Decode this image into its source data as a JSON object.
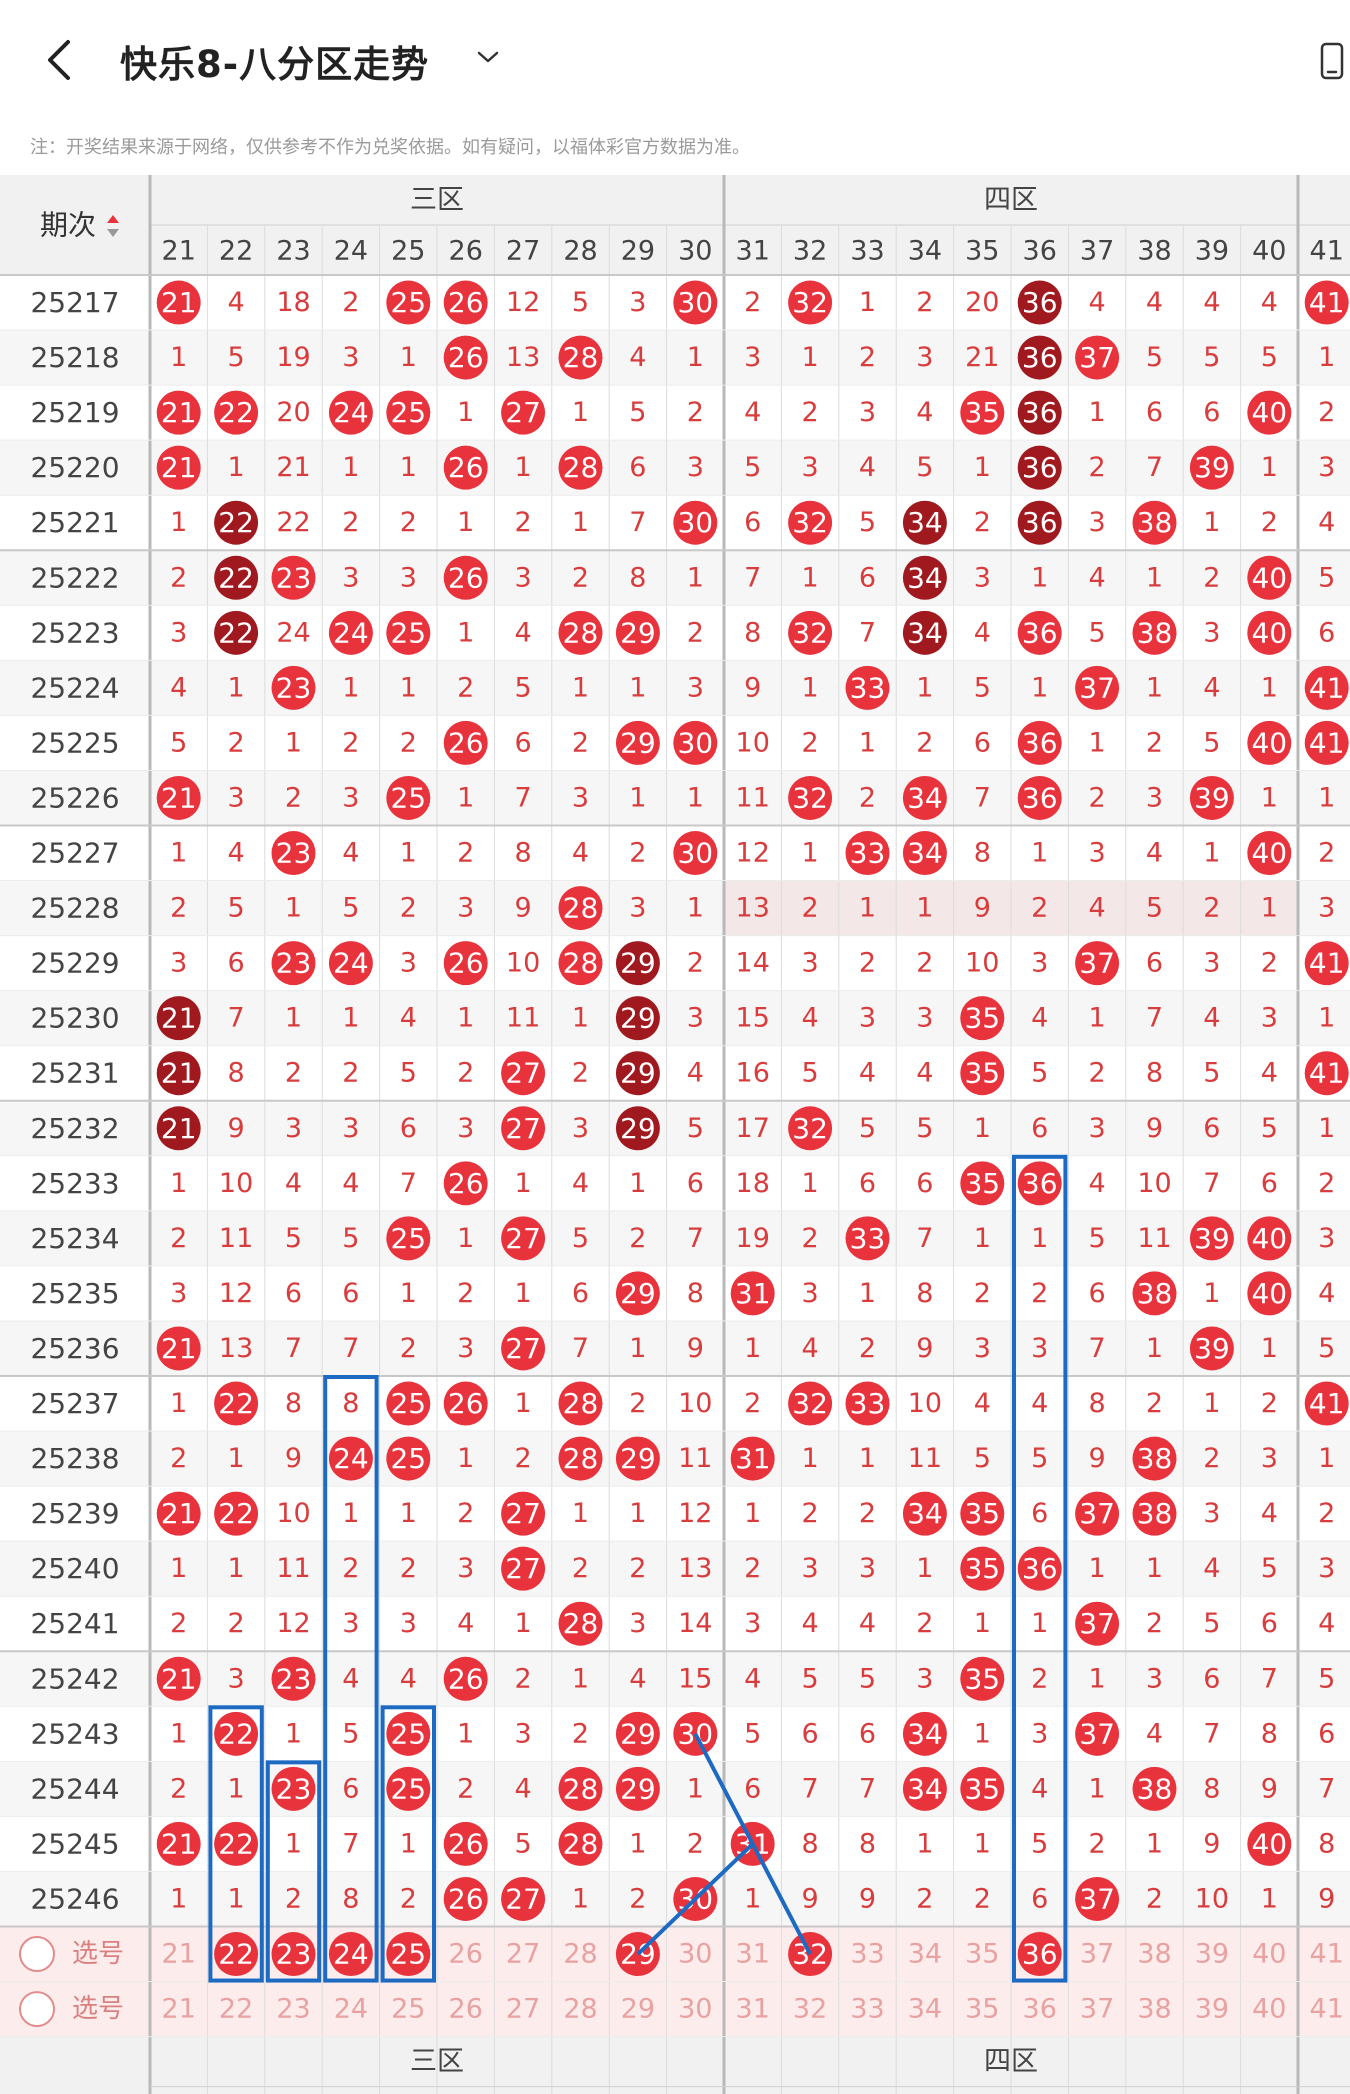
{
  "header": {
    "title": "快乐8-八分区走势",
    "note": "注：开奖结果来源于网络，仅供参考不作为兑奖依据。如有疑问，以福体彩官方数据为准。"
  },
  "table": {
    "period_header": "期次",
    "zones": [
      {
        "label": "三区",
        "first": 21,
        "last": 30
      },
      {
        "label": "四区",
        "first": 31,
        "last": 40
      }
    ],
    "extra_col": "41",
    "cols": [
      "21",
      "22",
      "23",
      "24",
      "25",
      "26",
      "27",
      "28",
      "29",
      "30",
      "31",
      "32",
      "33",
      "34",
      "35",
      "36",
      "37",
      "38",
      "39",
      "40",
      "41"
    ],
    "rows": [
      {
        "period": "25217",
        "cells": [
          "21",
          "4",
          "18",
          "2",
          "25",
          "26",
          "12",
          "5",
          "3",
          "30",
          "2",
          "32",
          "1",
          "2",
          "20",
          "36",
          "4",
          "4",
          "4",
          "4",
          "41"
        ]
      },
      {
        "period": "25218",
        "cells": [
          "1",
          "5",
          "19",
          "3",
          "1",
          "26",
          "13",
          "28",
          "4",
          "1",
          "3",
          "1",
          "2",
          "3",
          "21",
          "36",
          "37",
          "5",
          "5",
          "5",
          "1"
        ]
      },
      {
        "period": "25219",
        "cells": [
          "21",
          "22",
          "20",
          "24",
          "25",
          "1",
          "27",
          "1",
          "5",
          "2",
          "4",
          "2",
          "3",
          "4",
          "35",
          "36",
          "1",
          "6",
          "6",
          "40",
          "2"
        ]
      },
      {
        "period": "25220",
        "cells": [
          "21",
          "1",
          "21",
          "1",
          "1",
          "26",
          "1",
          "28",
          "6",
          "3",
          "5",
          "3",
          "4",
          "5",
          "1",
          "36",
          "2",
          "7",
          "39",
          "1",
          "3"
        ]
      },
      {
        "period": "25221",
        "cells": [
          "1",
          "22",
          "22",
          "2",
          "2",
          "1",
          "2",
          "1",
          "7",
          "30",
          "6",
          "32",
          "5",
          "34",
          "2",
          "36",
          "3",
          "38",
          "1",
          "2",
          "4"
        ]
      },
      {
        "period": "25222",
        "cells": [
          "2",
          "22",
          "23",
          "3",
          "3",
          "26",
          "3",
          "2",
          "8",
          "1",
          "7",
          "1",
          "6",
          "34",
          "3",
          "1",
          "4",
          "1",
          "2",
          "40",
          "5"
        ]
      },
      {
        "period": "25223",
        "cells": [
          "3",
          "22",
          "24",
          "24",
          "25",
          "1",
          "4",
          "28",
          "29",
          "2",
          "8",
          "32",
          "7",
          "34",
          "4",
          "36",
          "5",
          "38",
          "3",
          "40",
          "6"
        ]
      },
      {
        "period": "25224",
        "cells": [
          "4",
          "1",
          "23",
          "1",
          "1",
          "2",
          "5",
          "1",
          "1",
          "3",
          "9",
          "1",
          "33",
          "1",
          "5",
          "1",
          "37",
          "1",
          "4",
          "1",
          "41"
        ]
      },
      {
        "period": "25225",
        "cells": [
          "5",
          "2",
          "1",
          "2",
          "2",
          "26",
          "6",
          "2",
          "29",
          "30",
          "10",
          "2",
          "1",
          "2",
          "6",
          "36",
          "1",
          "2",
          "5",
          "40",
          "41"
        ]
      },
      {
        "period": "25226",
        "cells": [
          "21",
          "3",
          "2",
          "3",
          "25",
          "1",
          "7",
          "3",
          "1",
          "1",
          "11",
          "32",
          "2",
          "34",
          "7",
          "36",
          "2",
          "3",
          "39",
          "1",
          "1"
        ]
      },
      {
        "period": "25227",
        "cells": [
          "1",
          "4",
          "23",
          "4",
          "1",
          "2",
          "8",
          "4",
          "2",
          "30",
          "12",
          "1",
          "33",
          "34",
          "8",
          "1",
          "3",
          "4",
          "1",
          "40",
          "2"
        ]
      },
      {
        "period": "25228",
        "cells": [
          "2",
          "5",
          "1",
          "5",
          "2",
          "3",
          "9",
          "28",
          "3",
          "1",
          "13",
          "2",
          "1",
          "1",
          "9",
          "2",
          "4",
          "5",
          "2",
          "1",
          "3"
        ]
      },
      {
        "period": "25229",
        "cells": [
          "3",
          "6",
          "23",
          "24",
          "3",
          "26",
          "10",
          "28",
          "29",
          "2",
          "14",
          "3",
          "2",
          "2",
          "10",
          "3",
          "37",
          "6",
          "3",
          "2",
          "41"
        ]
      },
      {
        "period": "25230",
        "cells": [
          "21",
          "7",
          "1",
          "1",
          "4",
          "1",
          "11",
          "1",
          "29",
          "3",
          "15",
          "4",
          "3",
          "3",
          "35",
          "4",
          "1",
          "7",
          "4",
          "3",
          "1"
        ]
      },
      {
        "period": "25231",
        "cells": [
          "21",
          "8",
          "2",
          "2",
          "5",
          "2",
          "27",
          "2",
          "29",
          "4",
          "16",
          "5",
          "4",
          "4",
          "35",
          "5",
          "2",
          "8",
          "5",
          "4",
          "41"
        ]
      },
      {
        "period": "25232",
        "cells": [
          "21",
          "9",
          "3",
          "3",
          "6",
          "3",
          "27",
          "3",
          "29",
          "5",
          "17",
          "32",
          "5",
          "5",
          "1",
          "6",
          "3",
          "9",
          "6",
          "5",
          "1"
        ]
      },
      {
        "period": "25233",
        "cells": [
          "1",
          "10",
          "4",
          "4",
          "7",
          "26",
          "1",
          "4",
          "1",
          "6",
          "18",
          "1",
          "6",
          "6",
          "35",
          "36",
          "4",
          "10",
          "7",
          "6",
          "2"
        ]
      },
      {
        "period": "25234",
        "cells": [
          "2",
          "11",
          "5",
          "5",
          "25",
          "1",
          "27",
          "5",
          "2",
          "7",
          "19",
          "2",
          "33",
          "7",
          "1",
          "1",
          "5",
          "11",
          "39",
          "40",
          "3"
        ]
      },
      {
        "period": "25235",
        "cells": [
          "3",
          "12",
          "6",
          "6",
          "1",
          "2",
          "1",
          "6",
          "29",
          "8",
          "31",
          "3",
          "1",
          "8",
          "2",
          "2",
          "6",
          "38",
          "1",
          "40",
          "4"
        ]
      },
      {
        "period": "25236",
        "cells": [
          "21",
          "13",
          "7",
          "7",
          "2",
          "3",
          "27",
          "7",
          "1",
          "9",
          "1",
          "4",
          "2",
          "9",
          "3",
          "3",
          "7",
          "1",
          "39",
          "1",
          "5"
        ]
      },
      {
        "period": "25237",
        "cells": [
          "1",
          "22",
          "8",
          "8",
          "25",
          "26",
          "1",
          "28",
          "2",
          "10",
          "2",
          "32",
          "33",
          "10",
          "4",
          "4",
          "8",
          "2",
          "1",
          "2",
          "41"
        ]
      },
      {
        "period": "25238",
        "cells": [
          "2",
          "1",
          "9",
          "24",
          "25",
          "1",
          "2",
          "28",
          "29",
          "11",
          "31",
          "1",
          "1",
          "11",
          "5",
          "5",
          "9",
          "38",
          "2",
          "3",
          "1"
        ]
      },
      {
        "period": "25239",
        "cells": [
          "21",
          "22",
          "10",
          "1",
          "1",
          "2",
          "27",
          "1",
          "1",
          "12",
          "1",
          "2",
          "2",
          "34",
          "35",
          "6",
          "37",
          "38",
          "3",
          "4",
          "2"
        ]
      },
      {
        "period": "25240",
        "cells": [
          "1",
          "1",
          "11",
          "2",
          "2",
          "3",
          "27",
          "2",
          "2",
          "13",
          "2",
          "3",
          "3",
          "1",
          "35",
          "36",
          "1",
          "1",
          "4",
          "5",
          "3"
        ]
      },
      {
        "period": "25241",
        "cells": [
          "2",
          "2",
          "12",
          "3",
          "3",
          "4",
          "1",
          "28",
          "3",
          "14",
          "3",
          "4",
          "4",
          "2",
          "1",
          "1",
          "37",
          "2",
          "5",
          "6",
          "4"
        ]
      },
      {
        "period": "25242",
        "cells": [
          "21",
          "3",
          "23",
          "4",
          "4",
          "26",
          "2",
          "1",
          "4",
          "15",
          "4",
          "5",
          "5",
          "3",
          "35",
          "2",
          "1",
          "3",
          "6",
          "7",
          "5"
        ]
      },
      {
        "period": "25243",
        "cells": [
          "1",
          "22",
          "1",
          "5",
          "25",
          "1",
          "3",
          "2",
          "29",
          "30",
          "5",
          "6",
          "6",
          "34",
          "1",
          "3",
          "37",
          "4",
          "7",
          "8",
          "6"
        ]
      },
      {
        "period": "25244",
        "cells": [
          "2",
          "1",
          "23",
          "6",
          "25",
          "2",
          "4",
          "28",
          "29",
          "1",
          "6",
          "7",
          "7",
          "34",
          "35",
          "4",
          "1",
          "38",
          "8",
          "9",
          "7"
        ]
      },
      {
        "period": "25245",
        "cells": [
          "21",
          "22",
          "1",
          "7",
          "1",
          "26",
          "5",
          "28",
          "1",
          "2",
          "31",
          "8",
          "8",
          "1",
          "1",
          "5",
          "2",
          "1",
          "9",
          "40",
          "8"
        ]
      },
      {
        "period": "25246",
        "cells": [
          "1",
          "1",
          "2",
          "8",
          "2",
          "26",
          "27",
          "1",
          "2",
          "30",
          "1",
          "9",
          "9",
          "2",
          "2",
          "6",
          "37",
          "2",
          "10",
          "1",
          "9"
        ]
      }
    ],
    "dark_hits": [
      [
        15,
        0
      ],
      [
        15,
        1
      ],
      [
        15,
        2
      ],
      [
        15,
        3
      ],
      [
        15,
        4
      ],
      [
        1,
        4
      ],
      [
        1,
        5
      ],
      [
        1,
        6
      ],
      [
        13,
        4
      ],
      [
        13,
        5
      ],
      [
        13,
        6
      ],
      [
        0,
        13
      ],
      [
        0,
        14
      ],
      [
        0,
        15
      ],
      [
        8,
        12
      ],
      [
        8,
        13
      ],
      [
        8,
        14
      ],
      [
        8,
        15
      ]
    ],
    "select_rows": [
      {
        "label": "选号",
        "selected": [
          "22",
          "23",
          "24",
          "25",
          "29",
          "32",
          "36"
        ]
      },
      {
        "label": "选号",
        "selected": []
      }
    ],
    "footer_zones": [
      "三区",
      "四区"
    ],
    "colors": {
      "hit": "#e8323c",
      "hit_dark": "#a0191e",
      "text": "#d83c3c",
      "pale": "#e8a2a2",
      "header_bg": "#f1f1f1",
      "select_bg": "#fdecec",
      "highlight_row": "#f3e7e7",
      "blue": "#1d6ac2"
    }
  }
}
